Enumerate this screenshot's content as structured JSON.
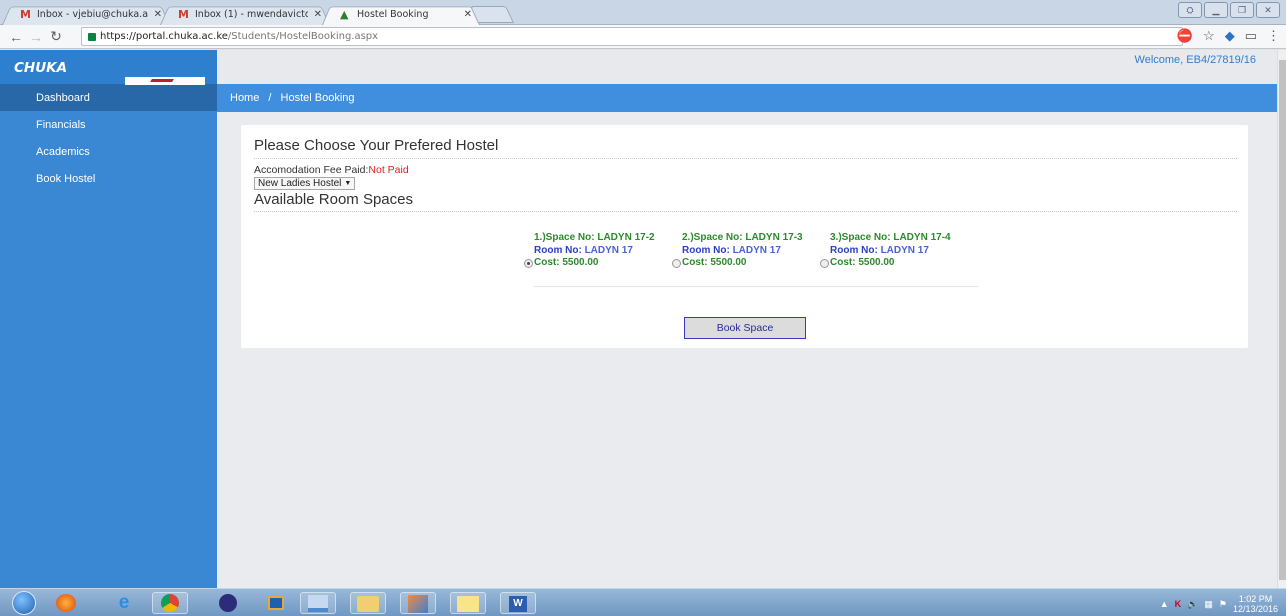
{
  "browser": {
    "tabs": [
      {
        "label": "Inbox - vjebiu@chuka.ac",
        "icon": "gmail-icon",
        "active": false
      },
      {
        "label": "Inbox (1) - mwendavicto",
        "icon": "gmail-icon",
        "active": false
      },
      {
        "label": "Hostel Booking",
        "icon": "site-favicon",
        "active": true
      }
    ],
    "url_host": "https://portal.chuka.ac.ke",
    "url_path": "/Students/HostelBooking.aspx"
  },
  "sidebar": {
    "brand": "CHUKA",
    "items": [
      {
        "label": "Dashboard",
        "active": true
      },
      {
        "label": "Financials",
        "active": false
      },
      {
        "label": "Academics",
        "active": false
      },
      {
        "label": "Book Hostel",
        "active": false
      }
    ]
  },
  "header": {
    "welcome": "Welcome, EB4/27819/16",
    "breadcrumb_home": "Home",
    "breadcrumb_sep": "/",
    "breadcrumb_current": "Hostel Booking"
  },
  "main": {
    "title": "Please Choose Your Prefered Hostel",
    "fee_label": "Accomodation Fee Paid:",
    "fee_status": "Not Paid",
    "hostel_selected": "New Ladies Hostel",
    "subtitle": "Available Room Spaces",
    "spaces": [
      {
        "space_label": "1.)Space No: LADYN 17-2",
        "room_label": "Room No:",
        "room_value": "LADYN 17",
        "cost": "Cost: 5500.00",
        "selected": true
      },
      {
        "space_label": "2.)Space No: LADYN 17-3",
        "room_label": "Room No:",
        "room_value": "LADYN 17",
        "cost": "Cost: 5500.00",
        "selected": false
      },
      {
        "space_label": "3.)Space No: LADYN 17-4",
        "room_label": "Room No:",
        "room_value": "LADYN 17",
        "cost": "Cost: 5500.00",
        "selected": false
      }
    ],
    "book_button": "Book Space"
  },
  "taskbar": {
    "time": "1:02 PM",
    "date": "12/13/2016"
  },
  "colors": {
    "sidebar": "#3a87d4",
    "breadcrumb_bar": "#3f8fde",
    "not_paid": "#e02020",
    "space_green": "#2b8a2b",
    "room_blue": "#2a3fc0"
  }
}
